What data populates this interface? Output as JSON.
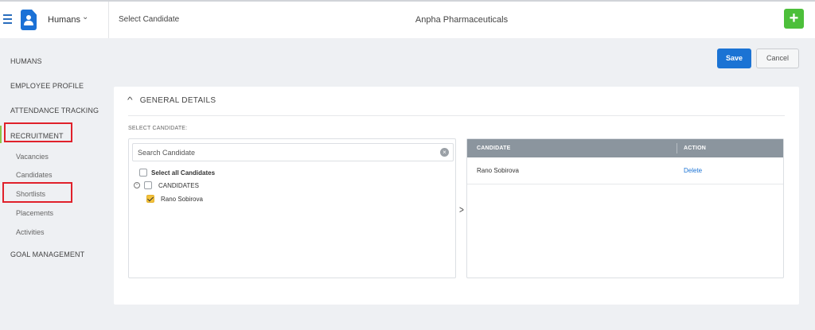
{
  "topbar": {
    "module": "Humans",
    "page_label": "Select Candidate",
    "company": "Anpha Pharmaceuticals",
    "add_label": "+"
  },
  "sidebar": {
    "items": [
      {
        "label": "HUMANS"
      },
      {
        "label": "EMPLOYEE PROFILE"
      },
      {
        "label": "ATTENDANCE TRACKING"
      },
      {
        "label": "RECRUITMENT"
      },
      {
        "label": "GOAL MANAGEMENT"
      }
    ],
    "recruitment_sub": [
      {
        "label": "Vacancies"
      },
      {
        "label": "Candidates"
      },
      {
        "label": "Shortlists"
      },
      {
        "label": "Placements"
      },
      {
        "label": "Activities"
      }
    ]
  },
  "actions": {
    "save": "Save",
    "cancel": "Cancel"
  },
  "section": {
    "title": "GENERAL DETAILS",
    "field_label": "SELECT CANDIDATE:"
  },
  "left_pane": {
    "search_placeholder": "Search Candidate",
    "select_all": "Select all Candidates",
    "group": "CANDIDATES",
    "items": [
      {
        "name": "Rano Sobirova",
        "checked": true
      }
    ]
  },
  "right_pane": {
    "columns": [
      "CANDIDATE",
      "ACTION"
    ],
    "rows": [
      {
        "candidate": "Rano Sobirova",
        "action": "Delete"
      }
    ]
  },
  "colors": {
    "primary": "#1b73d4",
    "add_button": "#4cbf3a",
    "highlight": "#e0212b",
    "active_nav": "#8ec64a",
    "table_header": "#8b959e"
  }
}
